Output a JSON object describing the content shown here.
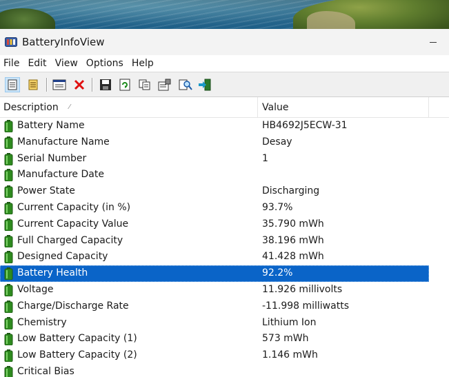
{
  "window": {
    "title": "BatteryInfoView"
  },
  "menu": [
    "File",
    "Edit",
    "View",
    "Options",
    "Help"
  ],
  "toolbar": {
    "icons": [
      "details-mode-icon",
      "log-mode-icon",
      "properties-window-icon",
      "delete-icon",
      "save-icon",
      "refresh-icon",
      "copy-icon",
      "properties-icon",
      "find-icon",
      "exit-icon"
    ]
  },
  "columns": {
    "description": "Description",
    "value": "Value"
  },
  "rows": [
    {
      "description": "Battery Name",
      "value": "HB4692J5ECW-31"
    },
    {
      "description": "Manufacture Name",
      "value": "Desay"
    },
    {
      "description": "Serial Number",
      "value": "1"
    },
    {
      "description": "Manufacture Date",
      "value": ""
    },
    {
      "description": "Power State",
      "value": "Discharging"
    },
    {
      "description": "Current Capacity (in %)",
      "value": "93.7%"
    },
    {
      "description": "Current Capacity Value",
      "value": "35.790 mWh"
    },
    {
      "description": "Full Charged Capacity",
      "value": "38.196 mWh"
    },
    {
      "description": "Designed Capacity",
      "value": "41.428 mWh"
    },
    {
      "description": "Battery Health",
      "value": "92.2%",
      "selected": true
    },
    {
      "description": "Voltage",
      "value": "11.926 millivolts"
    },
    {
      "description": "Charge/Discharge Rate",
      "value": "-11.998 milliwatts"
    },
    {
      "description": "Chemistry",
      "value": "Lithium Ion"
    },
    {
      "description": "Low Battery Capacity (1)",
      "value": "573 mWh"
    },
    {
      "description": "Low Battery Capacity (2)",
      "value": "1.146 mWh"
    },
    {
      "description": "Critical Bias",
      "value": ""
    }
  ],
  "colors": {
    "selection": "#0a64c8",
    "battery": "#2e8b1f"
  }
}
